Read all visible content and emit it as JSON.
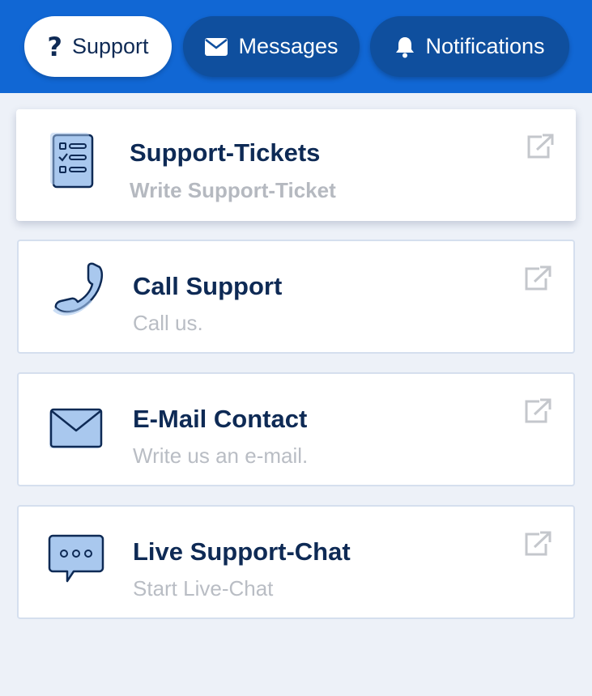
{
  "tabs": [
    {
      "label": "Support",
      "icon": "question-mark-icon",
      "active": true
    },
    {
      "label": "Messages",
      "icon": "envelope-icon",
      "active": false
    },
    {
      "label": "Notifications",
      "icon": "bell-icon",
      "active": false
    }
  ],
  "tab_icon_glyphs": {
    "support": "?"
  },
  "cards": [
    {
      "title": "Support-Tickets",
      "subtitle": "Write Support-Ticket",
      "icon": "checklist-icon"
    },
    {
      "title": "Call Support",
      "subtitle": "Call us.",
      "icon": "phone-icon"
    },
    {
      "title": "E-Mail Contact",
      "subtitle": "Write us an e-mail.",
      "icon": "mail-icon"
    },
    {
      "title": "Live Support-Chat",
      "subtitle": "Start Live-Chat",
      "icon": "chat-bubble-icon"
    }
  ],
  "colors": {
    "header": "#1167d4",
    "tab_inactive": "#0f4f9e",
    "tab_active": "#ffffff",
    "title_text": "#0e2a55",
    "subtitle_text": "#b9bdc4",
    "icon_fill": "#a9c8ee",
    "icon_stroke": "#0e2a55",
    "background": "#edf1f8"
  }
}
